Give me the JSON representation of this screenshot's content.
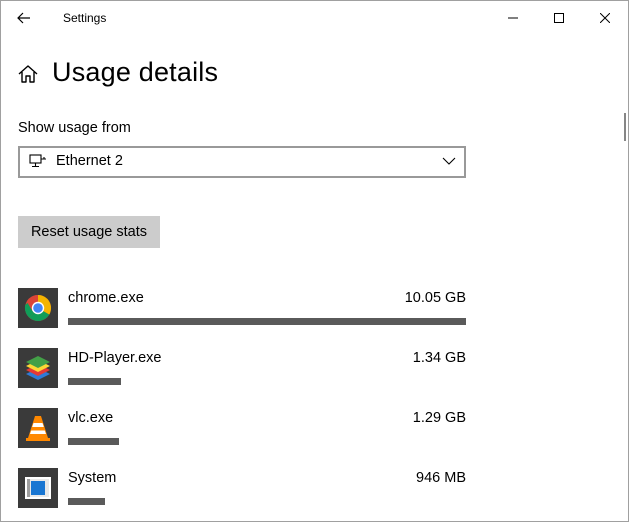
{
  "window": {
    "title": "Settings"
  },
  "icons": {
    "back": "back-arrow-icon",
    "minimize": "minimize-icon",
    "maximize": "maximize-icon",
    "close": "close-icon",
    "home": "home-icon",
    "network": "ethernet-icon",
    "dropdown": "chevron-down-icon"
  },
  "page": {
    "title": "Usage details",
    "show_usage_label": "Show usage from",
    "dropdown_value": "Ethernet 2",
    "reset_button": "Reset usage stats"
  },
  "apps": [
    {
      "name": "chrome.exe",
      "usage": "10.05 GB",
      "usage_fraction": 1.0,
      "icon": "chrome-icon"
    },
    {
      "name": "HD-Player.exe",
      "usage": "1.34 GB",
      "usage_fraction": 0.133,
      "icon": "bluestacks-icon"
    },
    {
      "name": "vlc.exe",
      "usage": "1.29 GB",
      "usage_fraction": 0.128,
      "icon": "vlc-icon"
    },
    {
      "name": "System",
      "usage": "946 MB",
      "usage_fraction": 0.092,
      "icon": "system-icon"
    }
  ],
  "colors": {
    "bar": "#5a5a5a",
    "button_bg": "#cccccc",
    "dropdown_border": "#999999",
    "icon_tile": "#3a3a3a"
  }
}
